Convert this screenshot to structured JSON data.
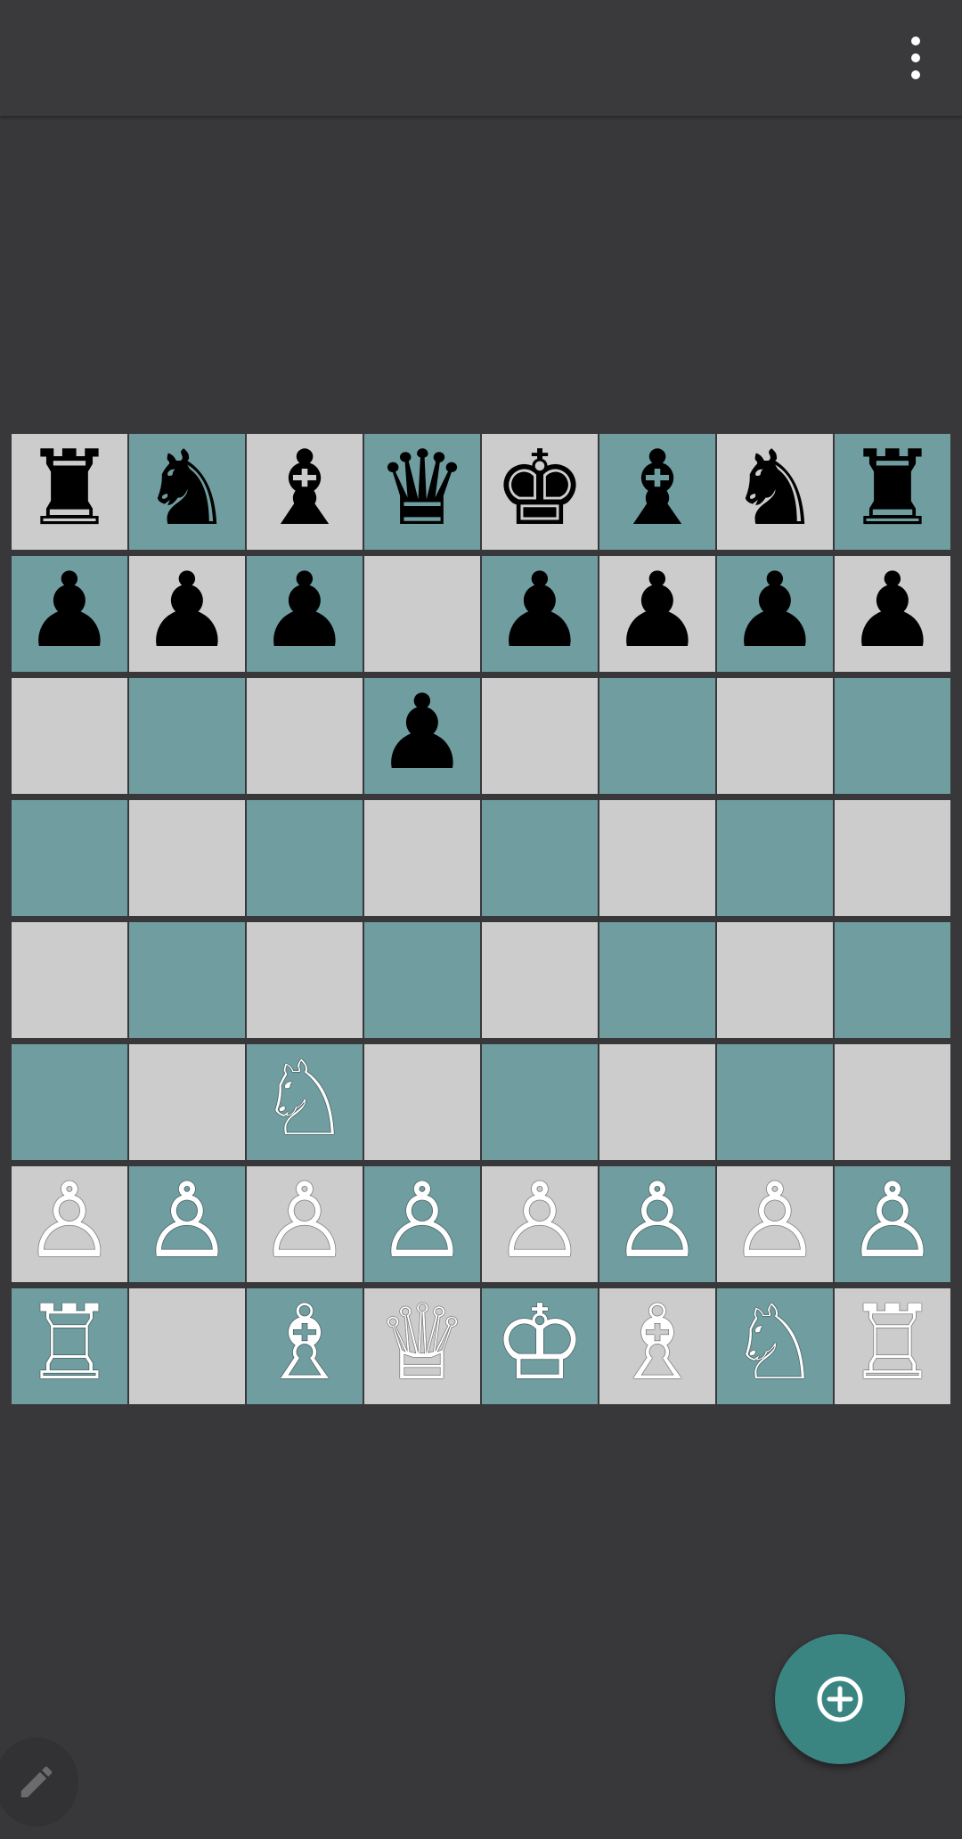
{
  "colors": {
    "background": "#38383b",
    "light_square": "#cccccc",
    "dark_square": "#6f9da0",
    "fab": "#3a8582"
  },
  "toolbar": {
    "menu_icon": "more-vert-icon"
  },
  "board": {
    "rows": [
      [
        "♜",
        "♞",
        "♝",
        "♛",
        "♚",
        "♝",
        "♞",
        "♜"
      ],
      [
        "♟",
        "♟",
        "♟",
        "",
        "♟",
        "♟",
        "♟",
        "♟"
      ],
      [
        "",
        "",
        "",
        "♟",
        "",
        "",
        "",
        ""
      ],
      [
        "",
        "",
        "",
        "",
        "",
        "",
        "",
        ""
      ],
      [
        "",
        "",
        "",
        "",
        "",
        "",
        "",
        ""
      ],
      [
        "",
        "",
        "♘",
        "",
        "",
        "",
        "",
        ""
      ],
      [
        "♙",
        "♙",
        "♙",
        "♙",
        "♙",
        "♙",
        "♙",
        "♙"
      ],
      [
        "♖",
        "",
        "♗",
        "♕",
        "♔",
        "♗",
        "♘",
        "♖"
      ]
    ],
    "colors": [
      [
        "b",
        "b",
        "b",
        "b",
        "b",
        "b",
        "b",
        "b"
      ],
      [
        "b",
        "b",
        "b",
        "",
        "b",
        "b",
        "b",
        "b"
      ],
      [
        "",
        "",
        "",
        "b",
        "",
        "",
        "",
        ""
      ],
      [
        "",
        "",
        "",
        "",
        "",
        "",
        "",
        ""
      ],
      [
        "",
        "",
        "",
        "",
        "",
        "",
        "",
        ""
      ],
      [
        "",
        "",
        "w",
        "",
        "",
        "",
        "",
        ""
      ],
      [
        "w",
        "w",
        "w",
        "w",
        "w",
        "w",
        "w",
        "w"
      ],
      [
        "w",
        "",
        "w",
        "w",
        "w",
        "w",
        "w",
        "w"
      ]
    ]
  },
  "fab": {
    "icon": "add-circle-icon"
  },
  "edit_button": {
    "icon": "pencil-icon"
  }
}
